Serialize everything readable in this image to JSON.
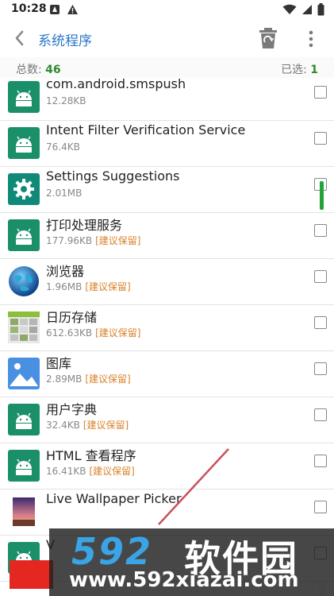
{
  "status_bar": {
    "time": "10:28"
  },
  "app_bar": {
    "title": "系统程序"
  },
  "summary": {
    "total_label": "总数:",
    "total_value": "46",
    "selected_label": "已选:",
    "selected_value": "1"
  },
  "apps": [
    {
      "name": "com.android.smspush",
      "size": "12.28KB",
      "tag": "",
      "icon": "android-icon"
    },
    {
      "name": "Intent Filter Verification Service",
      "size": "76.4KB",
      "tag": "",
      "icon": "android-icon"
    },
    {
      "name": "Settings Suggestions",
      "size": "2.01MB",
      "tag": "",
      "icon": "settings-gear-icon"
    },
    {
      "name": "打印处理服务",
      "size": "177.96KB",
      "tag": "[建议保留]",
      "icon": "android-icon"
    },
    {
      "name": "浏览器",
      "size": "1.96MB",
      "tag": "[建议保留]",
      "icon": "browser-globe-icon"
    },
    {
      "name": "日历存储",
      "size": "612.63KB",
      "tag": "[建议保留]",
      "icon": "calendar-storage-icon"
    },
    {
      "name": "图库",
      "size": "2.89MB",
      "tag": "[建议保留]",
      "icon": "gallery-icon"
    },
    {
      "name": "用户字典",
      "size": "32.4KB",
      "tag": "[建议保留]",
      "icon": "android-icon"
    },
    {
      "name": "HTML 查看程序",
      "size": "16.41KB",
      "tag": "[建议保留]",
      "icon": "android-icon"
    },
    {
      "name": "Live Wallpaper Picker",
      "size": "",
      "tag": "",
      "icon": "wallpaper-icon"
    },
    {
      "name": "V",
      "size": "",
      "tag": "",
      "icon": "android-icon"
    }
  ],
  "watermark": {
    "logo": "592",
    "brand": "软件园",
    "url": "www.592xiazai.com"
  },
  "colors": {
    "accent": "#2a78c6",
    "android_green": "#1a8f6a",
    "count_green": "#2e8b2e",
    "tag_orange": "#d9822b",
    "scroll_green": "#22a43a",
    "action_red": "#e52722"
  }
}
